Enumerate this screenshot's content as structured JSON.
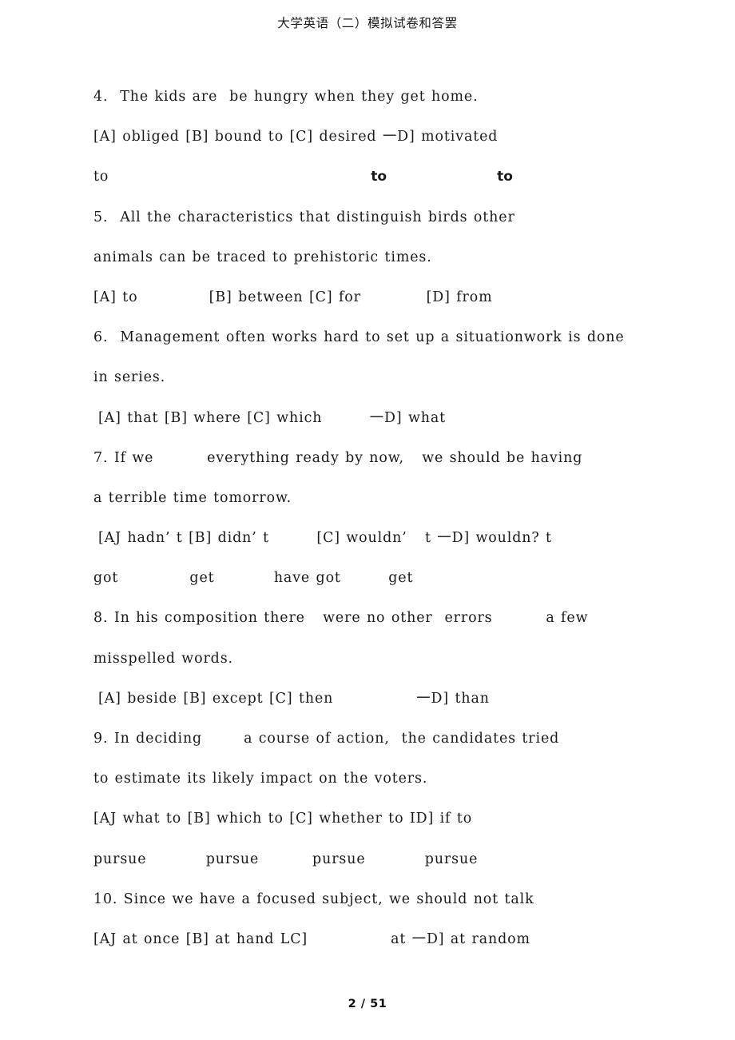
{
  "header": {
    "title": "大学英语（二）模拟试卷和答罢"
  },
  "footer": {
    "page_label": "2 / 51",
    "current_page": 2,
    "total_pages": 51
  },
  "document": {
    "lines": [
      {
        "id": "q4-stem",
        "text": "4.  The kids are  be hungry when they get home."
      },
      {
        "id": "q4-options",
        "text": "[A] obliged [B] bound to [C] desired 一D] motivated"
      },
      {
        "id": "q4-contwords",
        "text": "to"
      },
      {
        "id": "q5-stem-1",
        "text": "5.  All the characteristics that distinguish birds other"
      },
      {
        "id": "q5-stem-2",
        "text": "animals can be traced to prehistoric times."
      },
      {
        "id": "q5-options",
        "text": "[A] to            [B] between [C] for           [D] from"
      },
      {
        "id": "q6-stem-1",
        "text": "6.  Management often works hard to set up a situationwork is done"
      },
      {
        "id": "q6-stem-2",
        "text": "in series."
      },
      {
        "id": "q6-options",
        "text": "[A] that [B] where [C] which        一D] what"
      },
      {
        "id": "q7-stem-1",
        "text": "7. If we         everything ready by now,   we should be having"
      },
      {
        "id": "q7-stem-2",
        "text": "a terrible time tomorrow."
      },
      {
        "id": "q7-options",
        "text": "[AJ hadn’ t [B] didn’ t        [C] wouldn’   t 一D] wouldn? t"
      },
      {
        "id": "q7-contwords",
        "text": "got            get          have got        get"
      },
      {
        "id": "q8-stem-1",
        "text": "8. In his composition there   were no other  errors         a few"
      },
      {
        "id": "q8-stem-2",
        "text": "misspelled words."
      },
      {
        "id": "q8-options",
        "text": "[A] beside [B] except [C] then              一D] than"
      },
      {
        "id": "q9-stem-1",
        "text": "9. In deciding       a course of action,  the candidates tried"
      },
      {
        "id": "q9-stem-2",
        "text": "to estimate its likely impact on the voters."
      },
      {
        "id": "q9-options",
        "text": "[AJ what to [B] which to [C] whether to ID] if to"
      },
      {
        "id": "q9-contwords",
        "text": "pursue          pursue         pursue          pursue"
      },
      {
        "id": "q10-stem",
        "text": "10. Since we have a focused subject, we should not talk"
      },
      {
        "id": "q10-options",
        "text": "[AJ at once [B] at hand LC]              at 一D] at random"
      }
    ],
    "q4_continuation_tokens": {
      "first": "to",
      "second": "to",
      "third": "to"
    },
    "questions": [
      {
        "number": "4.",
        "stem": "The kids are  be hungry when they get home.",
        "options": [
          {
            "label": "[A]",
            "text": "obliged"
          },
          {
            "label": "[B]",
            "text": "bound to"
          },
          {
            "label": "[C]",
            "text": "desired"
          },
          {
            "label": "一D]",
            "text": "motivated"
          }
        ],
        "continuation": [
          "to",
          "to",
          "to"
        ]
      },
      {
        "number": "5.",
        "stem": "All the characteristics that distinguish birds other animals can be traced to prehistoric times.",
        "options": [
          {
            "label": "[A]",
            "text": "to"
          },
          {
            "label": "[B]",
            "text": "between"
          },
          {
            "label": "[C]",
            "text": "for"
          },
          {
            "label": "[D]",
            "text": "from"
          }
        ],
        "continuation": []
      },
      {
        "number": "6.",
        "stem": "Management often works hard to set up a situationwork is done in series.",
        "options": [
          {
            "label": "[A]",
            "text": "that"
          },
          {
            "label": "[B]",
            "text": "where"
          },
          {
            "label": "[C]",
            "text": "which"
          },
          {
            "label": "一D]",
            "text": "what"
          }
        ],
        "continuation": []
      },
      {
        "number": "7.",
        "stem": "If we         everything ready by now,   we should be having a terrible time tomorrow.",
        "options": [
          {
            "label": "[AJ",
            "text": "hadn’ t"
          },
          {
            "label": "[B]",
            "text": "didn’ t"
          },
          {
            "label": "[C]",
            "text": "wouldn’   t"
          },
          {
            "label": "一D]",
            "text": "wouldn? t"
          }
        ],
        "continuation": [
          "got",
          "get",
          "have got",
          "get"
        ]
      },
      {
        "number": "8.",
        "stem": "In his composition there   were no other  errors         a few misspelled words.",
        "options": [
          {
            "label": "[A]",
            "text": "beside"
          },
          {
            "label": "[B]",
            "text": "except"
          },
          {
            "label": "[C]",
            "text": "then"
          },
          {
            "label": "一D]",
            "text": "than"
          }
        ],
        "continuation": []
      },
      {
        "number": "9.",
        "stem": "In deciding       a course of action,  the candidates tried to estimate its likely impact on the voters.",
        "options": [
          {
            "label": "[AJ",
            "text": "what to"
          },
          {
            "label": "[B]",
            "text": "which to"
          },
          {
            "label": "[C]",
            "text": "whether to"
          },
          {
            "label": "ID]",
            "text": "if to"
          }
        ],
        "continuation": [
          "pursue",
          "pursue",
          "pursue",
          "pursue"
        ]
      },
      {
        "number": "10.",
        "stem": "Since we have a focused subject, we should not talk",
        "options": [
          {
            "label": "[AJ",
            "text": "at once"
          },
          {
            "label": "[B]",
            "text": "at hand"
          },
          {
            "label": "LC]",
            "text": "at"
          },
          {
            "label": "一D]",
            "text": "at random"
          }
        ],
        "continuation": []
      }
    ]
  },
  "colors": {
    "page_background": "#ffffff",
    "body_text": "#1a1a1a",
    "header_text": "#1b1b1b",
    "footer_text": "#101010"
  }
}
